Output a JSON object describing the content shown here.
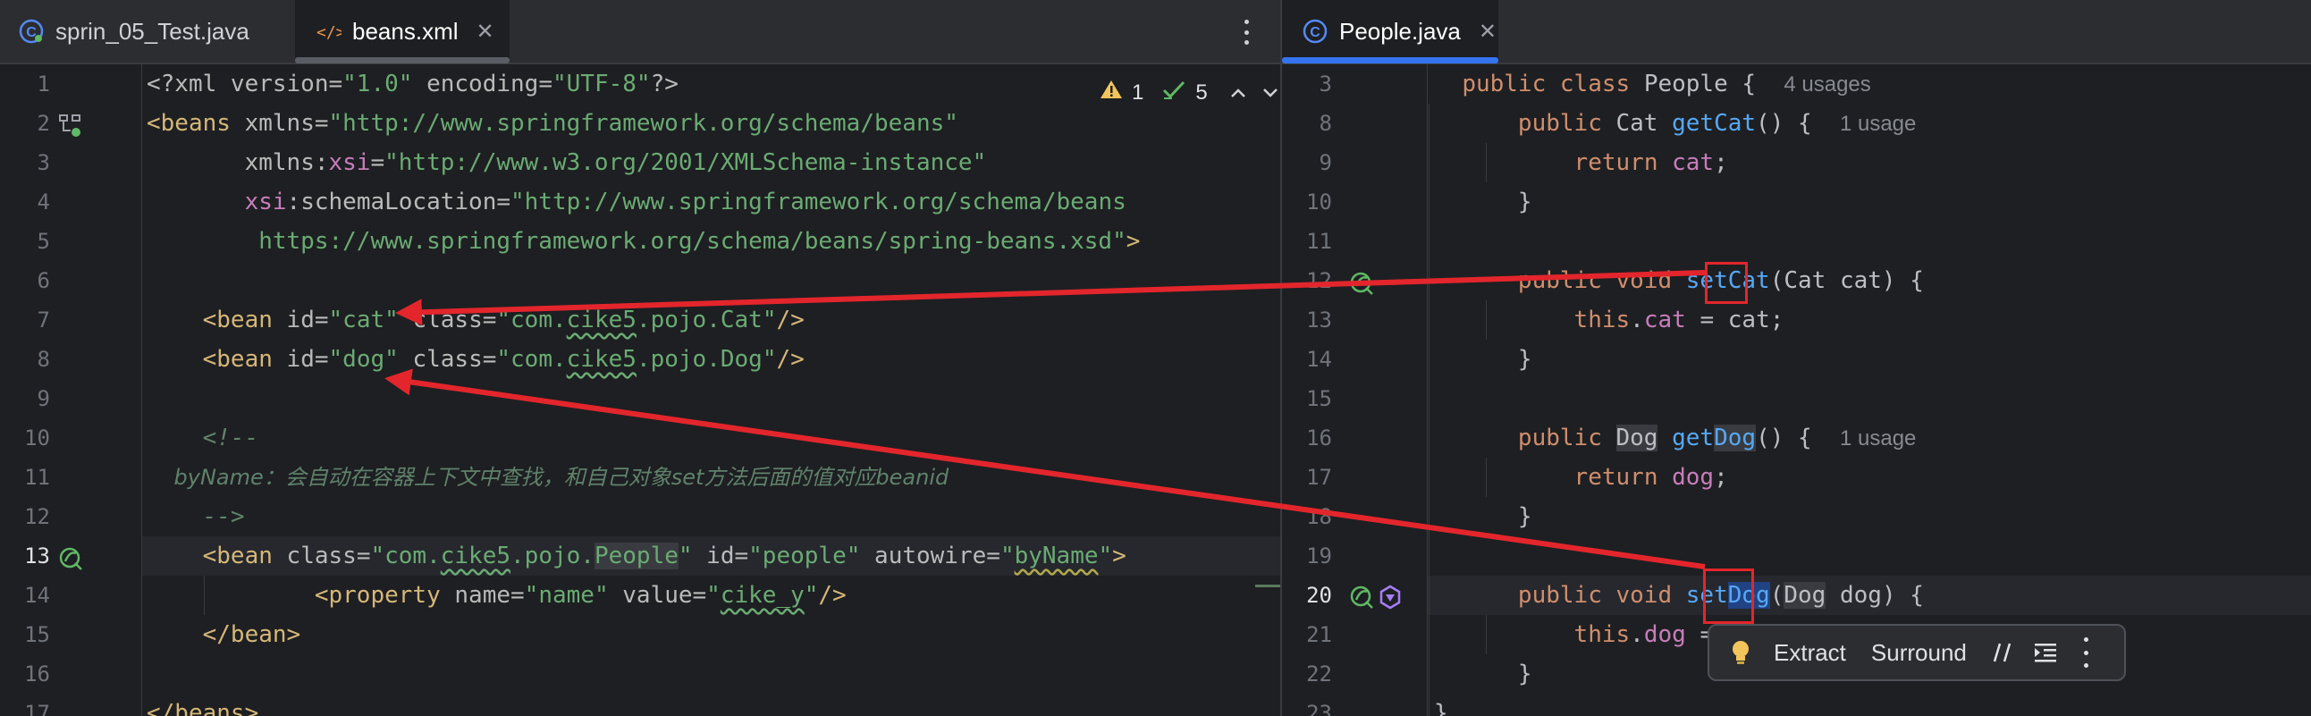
{
  "left_tabs": [
    {
      "label": "sprin_05_Test.java",
      "icon": "java-class-test-icon",
      "active": false
    },
    {
      "label": "beans.xml",
      "icon": "xml-file-icon",
      "active": true
    }
  ],
  "right_tabs": [
    {
      "label": "People.java",
      "icon": "java-class-icon",
      "active": true
    }
  ],
  "inspection": {
    "warnings": "1",
    "ok": "5"
  },
  "xml_line_numbers": [
    "1",
    "2",
    "3",
    "4",
    "5",
    "6",
    "7",
    "8",
    "9",
    "10",
    "11",
    "12",
    "13",
    "14",
    "15",
    "16",
    "17"
  ],
  "xml_lines": [
    "<?xml version=\"1.0\" encoding=\"UTF-8\"?>",
    "<beans xmlns=\"http://www.springframework.org/schema/beans\"",
    "       xmlns:xsi=\"http://www.w3.org/2001/XMLSchema-instance\"",
    "       xsi:schemaLocation=\"http://www.springframework.org/schema/beans",
    "        https://www.springframework.org/schema/beans/spring-beans.xsd\">",
    "",
    "    <bean id=\"cat\" class=\"com.cike5.pojo.Cat\"/>",
    "    <bean id=\"dog\" class=\"com.cike5.pojo.Dog\"/>",
    "",
    "    <!--",
    "    byName：会自动在容器上下文中查找，和自己对象set方法后面的值对应beanid",
    "    -->",
    "    <bean class=\"com.cike5.pojo.People\" id=\"people\" autowire=\"byName\">",
    "            <property name=\"name\" value=\"cike_y\"/>",
    "    </bean>",
    "",
    "</beans>"
  ],
  "java_line_numbers": [
    "3",
    "8",
    "9",
    "10",
    "11",
    "12",
    "13",
    "14",
    "15",
    "16",
    "17",
    "18",
    "19",
    "20",
    "21",
    "22",
    "23"
  ],
  "java_lines": [
    "public class People {",
    "    public Cat getCat() {",
    "        return cat;",
    "    }",
    "",
    "    public void setCat(Cat cat) {",
    "        this.cat = cat;",
    "    }",
    "",
    "    public Dog getDog() {",
    "        return dog;",
    "    }",
    "",
    "    public void setDog(Dog dog) {",
    "        this.dog = dog;",
    "    }",
    "}"
  ],
  "java_hints": {
    "class_usages": "4 usages",
    "getcat_usages": "1 usage",
    "getdog_usages": "1 usage"
  },
  "intention_popup": {
    "extract": "Extract",
    "surround": "Surround"
  },
  "colors": {
    "accent": "#3574f0",
    "annotation_red": "#e3262c",
    "background": "#1e1f22"
  }
}
